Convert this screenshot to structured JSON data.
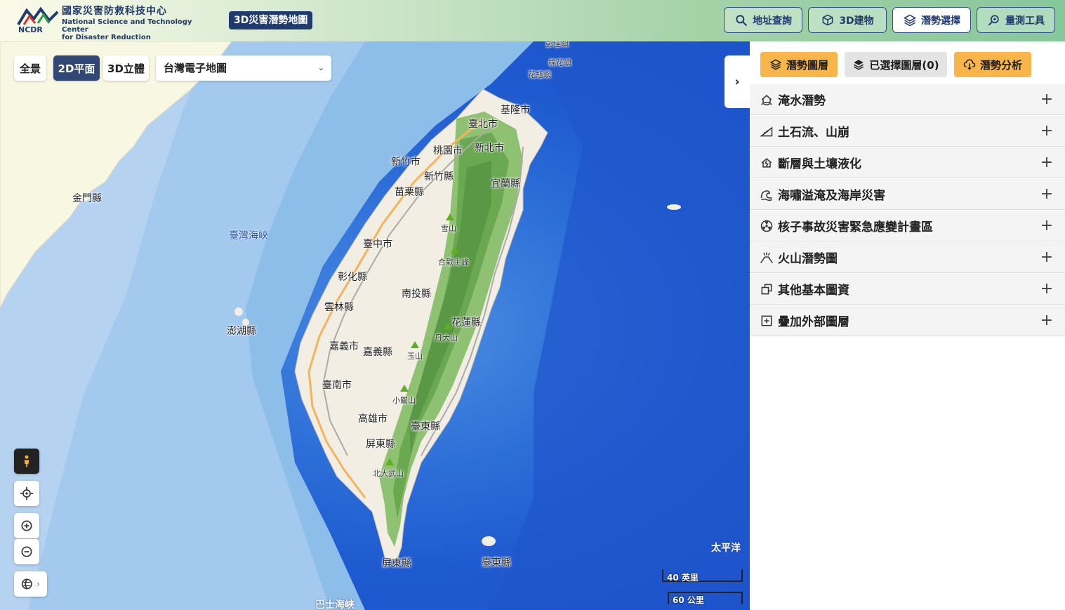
{
  "header": {
    "logo_zh": "國家災害防救科技中心",
    "logo_en_line1": "National Science and Technology Center",
    "logo_en_line2": "for Disaster Reduction",
    "logo_abbr": "NCDR",
    "app_title": "3D災害潛勢地圖",
    "nav": [
      {
        "label": "地址查詢",
        "icon": "search-icon"
      },
      {
        "label": "3D建物",
        "icon": "cube-icon"
      },
      {
        "label": "潛勢選擇",
        "icon": "layers-icon",
        "active": true
      },
      {
        "label": "量測工具",
        "icon": "measure-icon"
      }
    ]
  },
  "map": {
    "view_buttons": [
      {
        "label": "全景"
      },
      {
        "label": "2D平面",
        "active": true
      },
      {
        "label": "3D立體"
      }
    ],
    "basemap": "台灣電子地圖",
    "labels": {
      "keelung": "基隆市",
      "taipei": "臺北市",
      "taoyuan": "桃園市",
      "newtaipei": "新北市",
      "hsinchu_city": "新竹市",
      "hsinchu_county": "新竹縣",
      "yilan": "宜蘭縣",
      "miaoli": "苗栗縣",
      "kinmen": "金門縣",
      "strait": "臺灣海峽",
      "snow": "雪山",
      "hehuan": "合歡主峰",
      "taichung": "臺中市",
      "changhua": "彰化縣",
      "nantou": "南投縣",
      "yunlin": "雲林縣",
      "hualien": "花蓮縣",
      "danda": "丹大山",
      "penghu": "澎湖縣",
      "chiayi_city": "嘉義市",
      "chiayi_county": "嘉義縣",
      "yushan": "玉山",
      "tainan": "臺南市",
      "xiaoguan": "小關山",
      "kaohsiung": "高雄市",
      "taitung": "臺東縣",
      "pingtung": "屏東縣",
      "beidawu": "北大武山",
      "pingtung_south": "屏東縣",
      "taitung_island": "臺東縣",
      "pacific": "太平洋",
      "bashi": "巴士海峽",
      "mianhua": "棉花嶼",
      "huaping": "花瓶嶼",
      "pengjia": "彭佳嶼"
    },
    "scale_miles": "40 英里",
    "scale_km": "60 公里"
  },
  "panel": {
    "tabs": [
      {
        "label": "潛勢圖層",
        "icon": "layers-icon"
      },
      {
        "label": "已選擇圖層(0)",
        "icon": "stack-icon"
      },
      {
        "label": "潛勢分析",
        "icon": "cloud-download-icon"
      }
    ],
    "categories": [
      {
        "label": "淹水潛勢",
        "icon": "flood-house-icon"
      },
      {
        "label": "土石流、山崩",
        "icon": "landslide-icon"
      },
      {
        "label": "斷層與土壤液化",
        "icon": "fault-icon"
      },
      {
        "label": "海嘯溢淹及海岸災害",
        "icon": "wave-icon"
      },
      {
        "label": "核子事故災害緊急應變計畫區",
        "icon": "radiation-icon"
      },
      {
        "label": "火山潛勢圖",
        "icon": "volcano-icon"
      },
      {
        "label": "其他基本圖資",
        "icon": "copy-icon"
      },
      {
        "label": "疊加外部圖層",
        "icon": "add-box-icon"
      }
    ],
    "expand_symbol": "+"
  }
}
